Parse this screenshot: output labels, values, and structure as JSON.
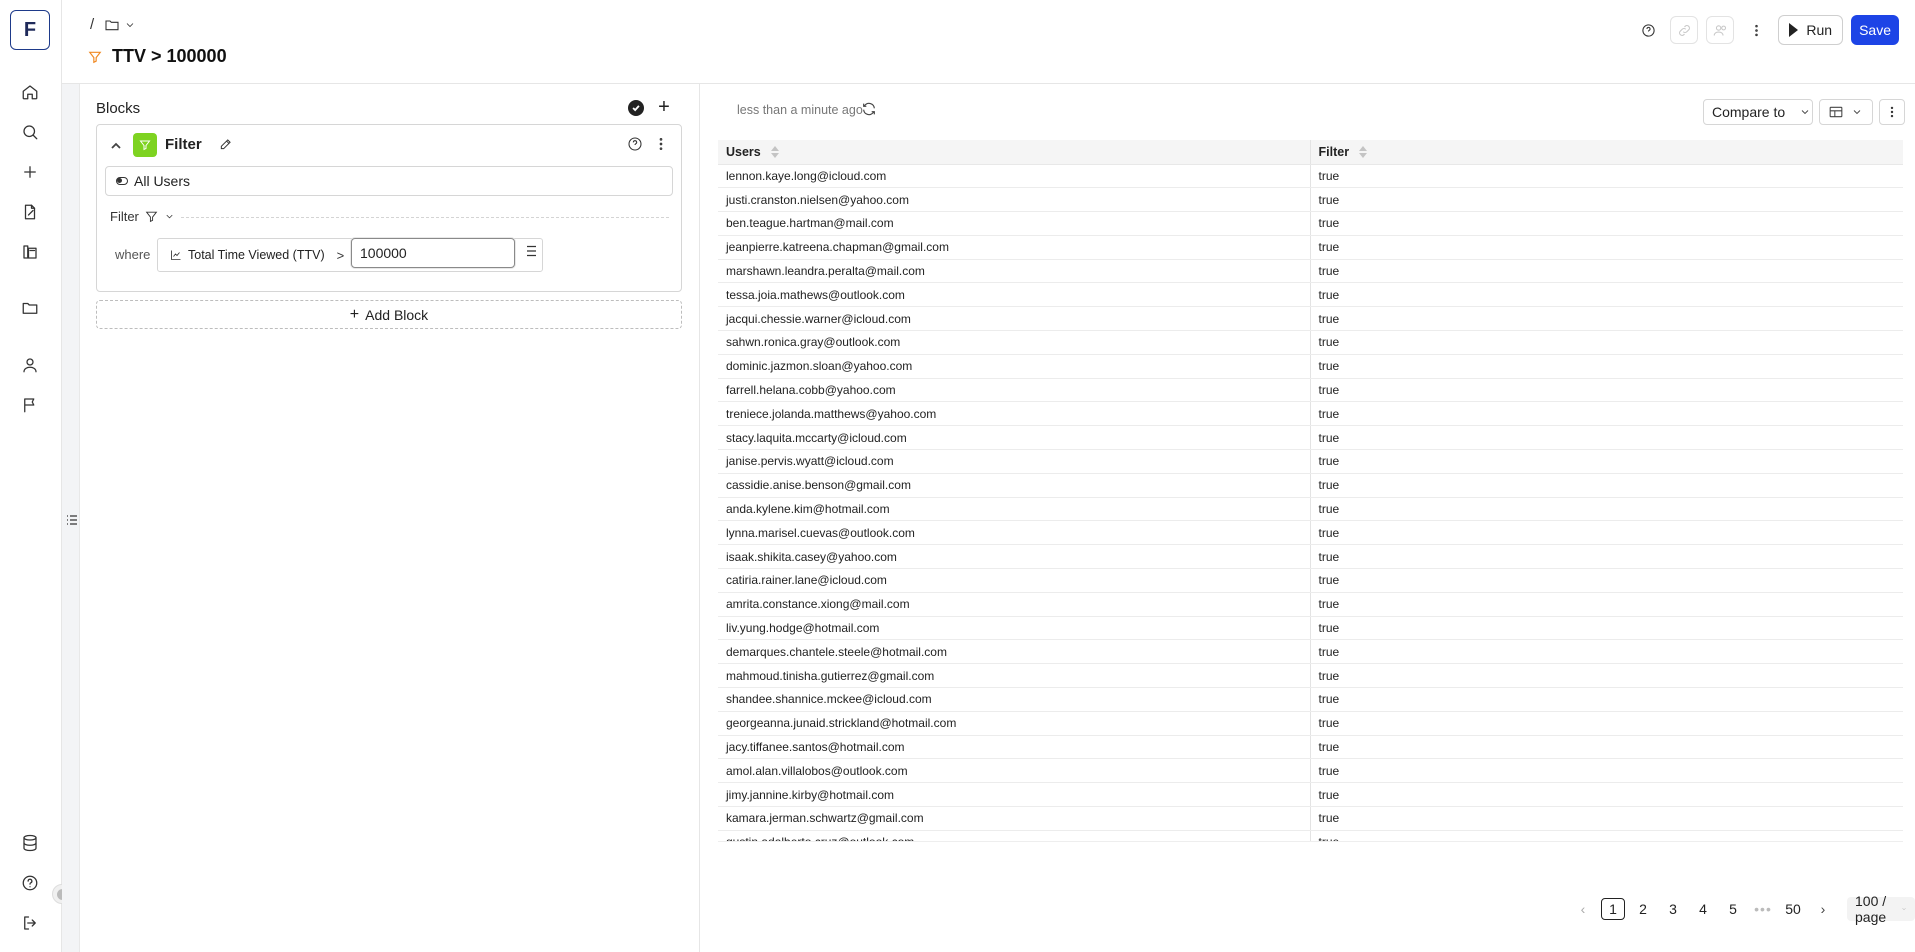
{
  "app": {
    "logo_letter": "F"
  },
  "header": {
    "breadcrumb_sep": "/",
    "title": "TTV > 100000",
    "run_label": "Run",
    "save_label": "Save"
  },
  "blocks": {
    "heading": "Blocks",
    "filter_block": {
      "title": "Filter",
      "source": "All Users",
      "sub_label": "Filter",
      "where_label": "where",
      "metric": "Total Time Viewed (TTV)",
      "operator": ">",
      "value": "100000"
    },
    "add_block_label": "Add Block"
  },
  "results": {
    "updated": "less than a minute ago",
    "compare_label": "Compare to",
    "columns": [
      "Users",
      "Filter"
    ],
    "rows": [
      [
        "lennon.kaye.long@icloud.com",
        "true"
      ],
      [
        "justi.cranston.nielsen@yahoo.com",
        "true"
      ],
      [
        "ben.teague.hartman@mail.com",
        "true"
      ],
      [
        "jeanpierre.katreena.chapman@gmail.com",
        "true"
      ],
      [
        "marshawn.leandra.peralta@mail.com",
        "true"
      ],
      [
        "tessa.joia.mathews@outlook.com",
        "true"
      ],
      [
        "jacqui.chessie.warner@icloud.com",
        "true"
      ],
      [
        "sahwn.ronica.gray@outlook.com",
        "true"
      ],
      [
        "dominic.jazmon.sloan@yahoo.com",
        "true"
      ],
      [
        "farrell.helana.cobb@yahoo.com",
        "true"
      ],
      [
        "treniece.jolanda.matthews@yahoo.com",
        "true"
      ],
      [
        "stacy.laquita.mccarty@icloud.com",
        "true"
      ],
      [
        "janise.pervis.wyatt@icloud.com",
        "true"
      ],
      [
        "cassidie.anise.benson@gmail.com",
        "true"
      ],
      [
        "anda.kylene.kim@hotmail.com",
        "true"
      ],
      [
        "lynna.marisel.cuevas@outlook.com",
        "true"
      ],
      [
        "isaak.shikita.casey@yahoo.com",
        "true"
      ],
      [
        "catiria.rainer.lane@icloud.com",
        "true"
      ],
      [
        "amrita.constance.xiong@mail.com",
        "true"
      ],
      [
        "liv.yung.hodge@hotmail.com",
        "true"
      ],
      [
        "demarques.chantele.steele@hotmail.com",
        "true"
      ],
      [
        "mahmoud.tinisha.gutierrez@gmail.com",
        "true"
      ],
      [
        "shandee.shannice.mckee@icloud.com",
        "true"
      ],
      [
        "georgeanna.junaid.strickland@hotmail.com",
        "true"
      ],
      [
        "jacy.tiffanee.santos@hotmail.com",
        "true"
      ],
      [
        "amol.alan.villalobos@outlook.com",
        "true"
      ],
      [
        "jimy.jannine.kirby@hotmail.com",
        "true"
      ],
      [
        "kamara.jerman.schwartz@gmail.com",
        "true"
      ],
      [
        "gustin.adalberto.cruz@outlook.com",
        "true"
      ]
    ]
  },
  "pagination": {
    "pages": [
      "1",
      "2",
      "3",
      "4",
      "5"
    ],
    "ellipsis": "•••",
    "last_page": "50",
    "page_size": "100 / page"
  }
}
